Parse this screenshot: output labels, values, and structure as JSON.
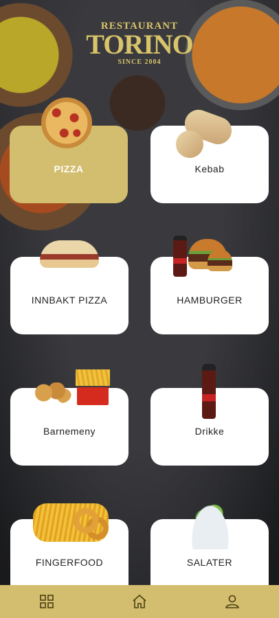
{
  "brand": {
    "line1": "RESTAURANT",
    "line2": "TORINO",
    "line3": "SINCE 2004"
  },
  "categories": [
    {
      "label": "PIZZA",
      "active": true
    },
    {
      "label": "Kebab",
      "active": false
    },
    {
      "label": "INNBAKT PIZZA",
      "active": false
    },
    {
      "label": "HAMBURGER",
      "active": false
    },
    {
      "label": "Barnemeny",
      "active": false
    },
    {
      "label": "Drikke",
      "active": false
    },
    {
      "label": "FINGERFOOD",
      "active": false
    },
    {
      "label": "SALATER",
      "active": false
    }
  ],
  "bottom_nav": [
    {
      "icon": "grid-icon"
    },
    {
      "icon": "home-icon"
    },
    {
      "icon": "user-icon"
    }
  ],
  "colors": {
    "accent": "#d3bd6e",
    "card": "#ffffff"
  }
}
